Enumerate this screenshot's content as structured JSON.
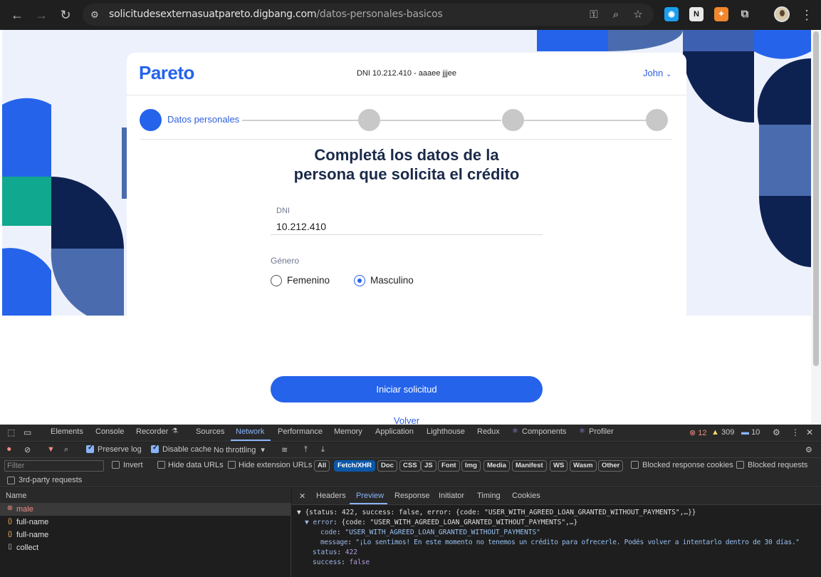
{
  "browser": {
    "url_host": "solicitudesexternasuatpareto.digbang.com",
    "url_path": "/datos-personales-basicos"
  },
  "page": {
    "logo": "Pareto",
    "header_dni": "DNI 10.212.410 - aaaee jjjee",
    "user_name": "John",
    "step_1_label": "Datos personales",
    "title_line1": "Completá los datos de la",
    "title_line2": "persona que solicita el crédito",
    "dni_label": "DNI",
    "dni_value": "10.212.410",
    "gender_label": "Género",
    "gender_options": [
      "Femenino",
      "Masculino"
    ],
    "gender_selected": "Masculino",
    "submit_label": "Iniciar solicitud",
    "back_label": "Volver"
  },
  "devtools": {
    "tabs": [
      "Elements",
      "Console",
      "Recorder",
      "Sources",
      "Network",
      "Performance",
      "Memory",
      "Application",
      "Lighthouse",
      "Redux",
      "Components",
      "Profiler"
    ],
    "active_tab": "Network",
    "errors": "12",
    "warnings": "309",
    "messages": "10",
    "toolbar": {
      "preserve_log": "Preserve log",
      "disable_cache": "Disable cache",
      "throttling": "No throttling"
    },
    "filter": {
      "placeholder": "Filter",
      "invert": "Invert",
      "hide_data_urls": "Hide data URLs",
      "hide_ext_urls": "Hide extension URLs",
      "chips": [
        "All",
        "Fetch/XHR",
        "Doc",
        "CSS",
        "JS",
        "Font",
        "Img",
        "Media",
        "Manifest",
        "WS",
        "Wasm",
        "Other"
      ],
      "active_chip": "Fetch/XHR",
      "blocked_cookies": "Blocked response cookies",
      "blocked_requests": "Blocked requests",
      "third_party": "3rd-party requests"
    },
    "name_header": "Name",
    "requests": [
      "male",
      "full-name",
      "full-name",
      "collect"
    ],
    "preview_tabs": [
      "Headers",
      "Preview",
      "Response",
      "Initiator",
      "Timing",
      "Cookies"
    ],
    "active_preview_tab": "Preview",
    "preview": {
      "line1": "▼ {status: 422, success: false, error: {code: \"USER_WITH_AGREED_LOAN_GRANTED_WITHOUT_PAYMENTS\",…}}",
      "error_key": "▼ error",
      "error_summary": ": {code: \"USER_WITH_AGREED_LOAN_GRANTED_WITHOUT_PAYMENTS\",…}",
      "code_key": "code",
      "code_value": "\"USER_WITH_AGREED_LOAN_GRANTED_WITHOUT_PAYMENTS\"",
      "message_key": "message",
      "message_value": "\"¡Lo sentimos! En este momento no tenemos un crédito para ofrecerle. Podés volver a intentarlo dentro de 30 días.\"",
      "status_key": "status",
      "status_value": "422",
      "success_key": "success",
      "success_value": "false"
    }
  }
}
